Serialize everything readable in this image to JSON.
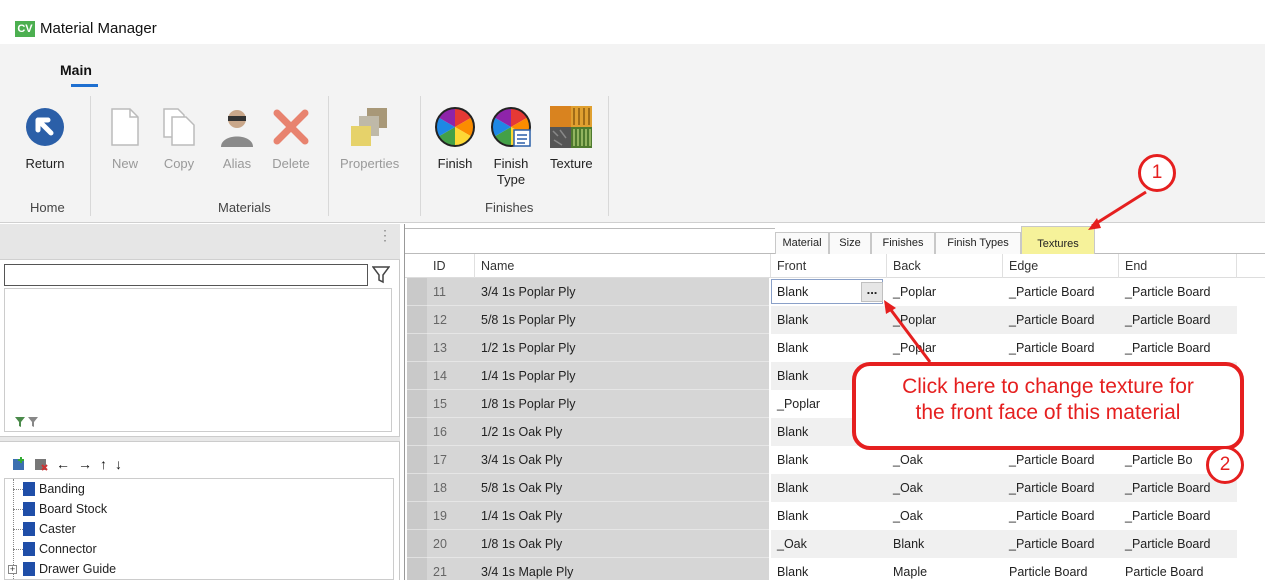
{
  "app": {
    "logo": "CV",
    "title": "Material Manager"
  },
  "ribbon": {
    "tab": "Main",
    "buttons": {
      "return": "Return",
      "new": "New",
      "copy": "Copy",
      "alias": "Alias",
      "delete": "Delete",
      "properties": "Properties",
      "finish": "Finish",
      "finish_type_line1": "Finish",
      "finish_type_line2": "Type",
      "texture": "Texture"
    },
    "groups": {
      "home": "Home",
      "materials": "Materials",
      "finishes": "Finishes"
    }
  },
  "left_panel": {
    "filter_value": "",
    "tree": [
      "Banding",
      "Board Stock",
      "Caster",
      "Connector",
      "Drawer Guide"
    ]
  },
  "grid": {
    "tabs": [
      "Material",
      "Size",
      "Finishes",
      "Finish Types",
      "Textures"
    ],
    "active_tab": "Textures",
    "columns": [
      "ID",
      "Name",
      "Front",
      "Back",
      "Edge",
      "End"
    ],
    "rows": [
      {
        "id": "11",
        "name": "3/4 1s Poplar Ply",
        "front": "Blank",
        "back": "_Poplar",
        "edge": "_Particle Board",
        "end": "_Particle Board"
      },
      {
        "id": "12",
        "name": "5/8 1s Poplar Ply",
        "front": "Blank",
        "back": "_Poplar",
        "edge": "_Particle Board",
        "end": "_Particle Board"
      },
      {
        "id": "13",
        "name": "1/2 1s Poplar Ply",
        "front": "Blank",
        "back": "_Poplar",
        "edge": "_Particle Board",
        "end": "_Particle Board"
      },
      {
        "id": "14",
        "name": "1/4 1s Poplar Ply",
        "front": "Blank",
        "back": "",
        "edge": "",
        "end": ""
      },
      {
        "id": "15",
        "name": "1/8 1s Poplar Ply",
        "front": "_Poplar",
        "back": "",
        "edge": "",
        "end": ""
      },
      {
        "id": "16",
        "name": "1/2 1s Oak Ply",
        "front": "Blank",
        "back": "",
        "edge": "",
        "end": ""
      },
      {
        "id": "17",
        "name": "3/4 1s Oak Ply",
        "front": "Blank",
        "back": "_Oak",
        "edge": "_Particle Board",
        "end": "_Particle Bo"
      },
      {
        "id": "18",
        "name": "5/8 1s Oak Ply",
        "front": "Blank",
        "back": "_Oak",
        "edge": "_Particle Board",
        "end": "_Particle Board"
      },
      {
        "id": "19",
        "name": "1/4 1s Oak Ply",
        "front": "Blank",
        "back": "_Oak",
        "edge": "_Particle Board",
        "end": "_Particle Board"
      },
      {
        "id": "20",
        "name": "1/8 1s Oak Ply",
        "front": "_Oak",
        "back": "Blank",
        "edge": "_Particle Board",
        "end": "_Particle Board"
      },
      {
        "id": "21",
        "name": "3/4 1s Maple Ply",
        "front": "Blank",
        "back": "Maple",
        "edge": "Particle Board",
        "end": "Particle Board"
      }
    ],
    "ellipsis": "..."
  },
  "annotations": {
    "marker1": "1",
    "marker2": "2",
    "callout_line1": "Click here to change texture for",
    "callout_line2": "the front face of this material",
    "color": "#e51f1f"
  },
  "colors": {
    "accent": "#1e6fd0",
    "highlight_tab": "#f6f29a",
    "logo": "#4caf50"
  }
}
